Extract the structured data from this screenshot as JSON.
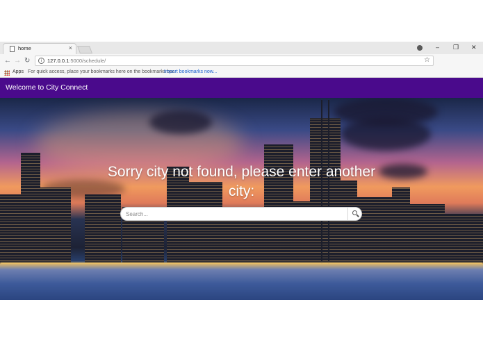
{
  "browser": {
    "tab_title": "home",
    "tab_close": "×",
    "url_host": "127.0.0.1",
    "url_path": ":5000/schedule/",
    "bookmarks_apps": "Apps",
    "bookmarks_hint": "For quick access, place your bookmarks here on the bookmarks bar.",
    "bookmarks_import": "Import bookmarks now...",
    "controls": {
      "minimize": "–",
      "restore": "❐",
      "close": "✕"
    },
    "nav": {
      "back": "←",
      "forward": "→",
      "reload": "↻"
    },
    "extension_colors": [
      "#f0a040",
      "#d32f2f",
      "#c62828"
    ]
  },
  "navbar": {
    "brand": "Welcome to City Connect",
    "color": "#4a0a8c"
  },
  "hero": {
    "message": "Sorry city not found, please enter another city:",
    "search": {
      "placeholder": "Search..."
    }
  }
}
